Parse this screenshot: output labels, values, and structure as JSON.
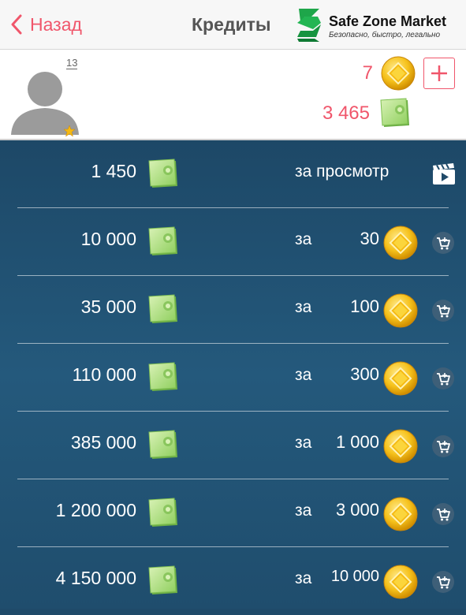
{
  "nav": {
    "back_label": "Назад",
    "title": "Кредиты"
  },
  "logo": {
    "name": "Safe Zone Market",
    "tagline": "Безопасно, быстро, легально"
  },
  "profile": {
    "level": "13",
    "gold": "7",
    "cash": "3 465"
  },
  "offers": [
    {
      "amount": "1 450",
      "action": "за просмотр",
      "type": "video"
    },
    {
      "amount": "10 000",
      "za": "за",
      "price": "30",
      "type": "buy"
    },
    {
      "amount": "35 000",
      "za": "за",
      "price": "100",
      "type": "buy"
    },
    {
      "amount": "110 000",
      "za": "за",
      "price": "300",
      "type": "buy"
    },
    {
      "amount": "385 000",
      "za": "за",
      "price": "1 000",
      "type": "buy"
    },
    {
      "amount": "1 200 000",
      "za": "за",
      "price": "3 000",
      "type": "buy"
    },
    {
      "amount": "4 150 000",
      "za": "за",
      "price": "10 000",
      "type": "buy"
    }
  ],
  "colors": {
    "accent": "#f0566b",
    "list_bg": "#1f4a69",
    "brand_green": "#19a34a"
  },
  "icons": {
    "back": "chevron-left-icon",
    "add": "plus-icon",
    "gold": "gold-coin-icon",
    "cash": "cash-bill-icon",
    "video": "film-icon",
    "cart": "cart-add-icon"
  }
}
